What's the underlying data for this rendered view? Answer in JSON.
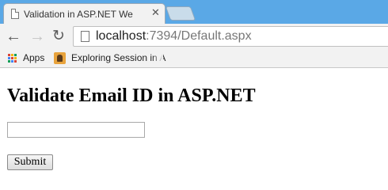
{
  "browser": {
    "tab": {
      "title": "Validation in ASP.NET We",
      "close_glyph": "✕",
      "icon": "page-icon"
    },
    "nav": {
      "back_glyph": "←",
      "forward_glyph": "→",
      "reload_glyph": "↻"
    },
    "address": {
      "host": "localhost",
      "path": ":7394/Default.aspx"
    },
    "bookmarks": [
      {
        "label": "Apps",
        "icon": "apps-grid-icon"
      },
      {
        "label": "Exploring Session in A",
        "icon": "bookmark-favicon"
      }
    ],
    "colors": {
      "tabbar": "#5aa8e6",
      "toolbar": "#f2f2f2"
    }
  },
  "page": {
    "heading": "Validate Email ID in ASP.NET",
    "email_input": {
      "value": "",
      "placeholder": ""
    },
    "submit_label": "Submit"
  }
}
